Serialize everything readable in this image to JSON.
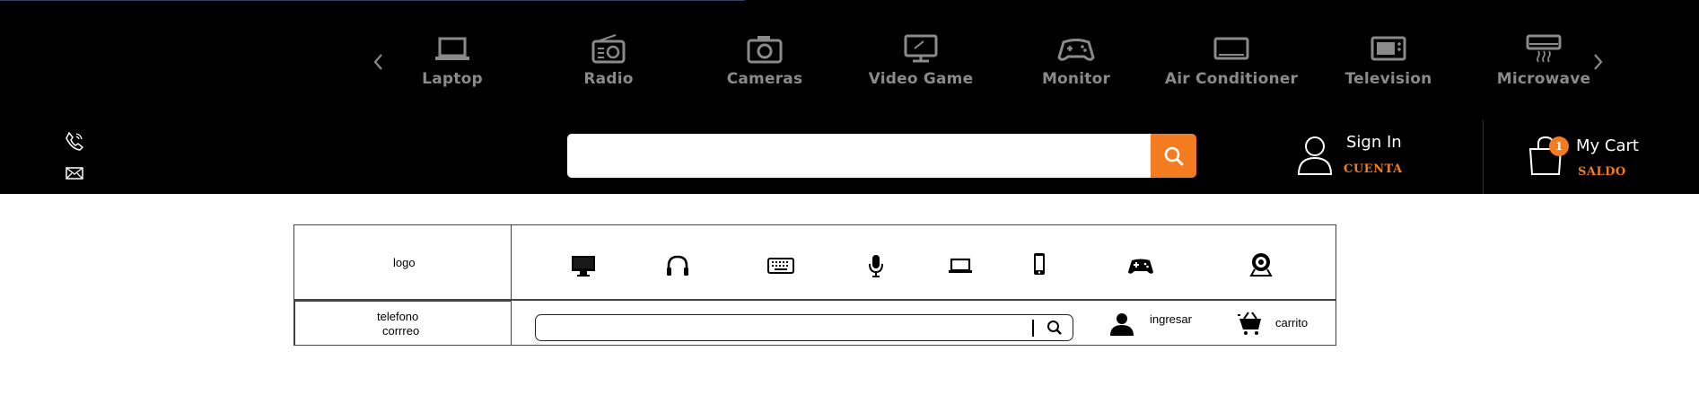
{
  "categories": [
    {
      "label": "Laptop",
      "icon": "laptop-icon"
    },
    {
      "label": "Radio",
      "icon": "radio-icon"
    },
    {
      "label": "Cameras",
      "icon": "camera-icon"
    },
    {
      "label": "Video Game",
      "icon": "monitor-game-icon"
    },
    {
      "label": "Monitor",
      "icon": "gamepad-icon"
    },
    {
      "label": "Air Conditioner",
      "icon": "air-conditioner-icon"
    },
    {
      "label": "Television",
      "icon": "television-icon"
    },
    {
      "label": "Microwave",
      "icon": "microwave-icon"
    }
  ],
  "carousel": {
    "prev_icon": "chevron-left-icon",
    "next_icon": "chevron-right-icon"
  },
  "contact": {
    "phone_icon": "phone-icon",
    "mail_icon": "mail-icon"
  },
  "search": {
    "placeholder": "",
    "value": "",
    "button_icon": "search-icon"
  },
  "account": {
    "title": "Sign In",
    "subtitle": "CUENTA",
    "icon": "user-icon"
  },
  "cart": {
    "title": "My Cart",
    "subtitle": "SALDO",
    "count": "1",
    "icon": "shopping-bag-icon"
  },
  "colors": {
    "background": "#000000",
    "accent": "#f47c20",
    "category_text": "#8a8a8a",
    "text": "#ffffff"
  },
  "wireframe": {
    "logo": "logo",
    "contact_line1": "telefono",
    "contact_line2": "corrreo",
    "icons": [
      "desktop-icon",
      "headphones-icon",
      "keyboard-icon",
      "microphone-icon",
      "laptop-icon",
      "smartphone-icon",
      "gamepad-icon",
      "webcam-icon"
    ],
    "login_label": "ingresar",
    "cart_label": "carrito",
    "search_placeholder": ""
  }
}
